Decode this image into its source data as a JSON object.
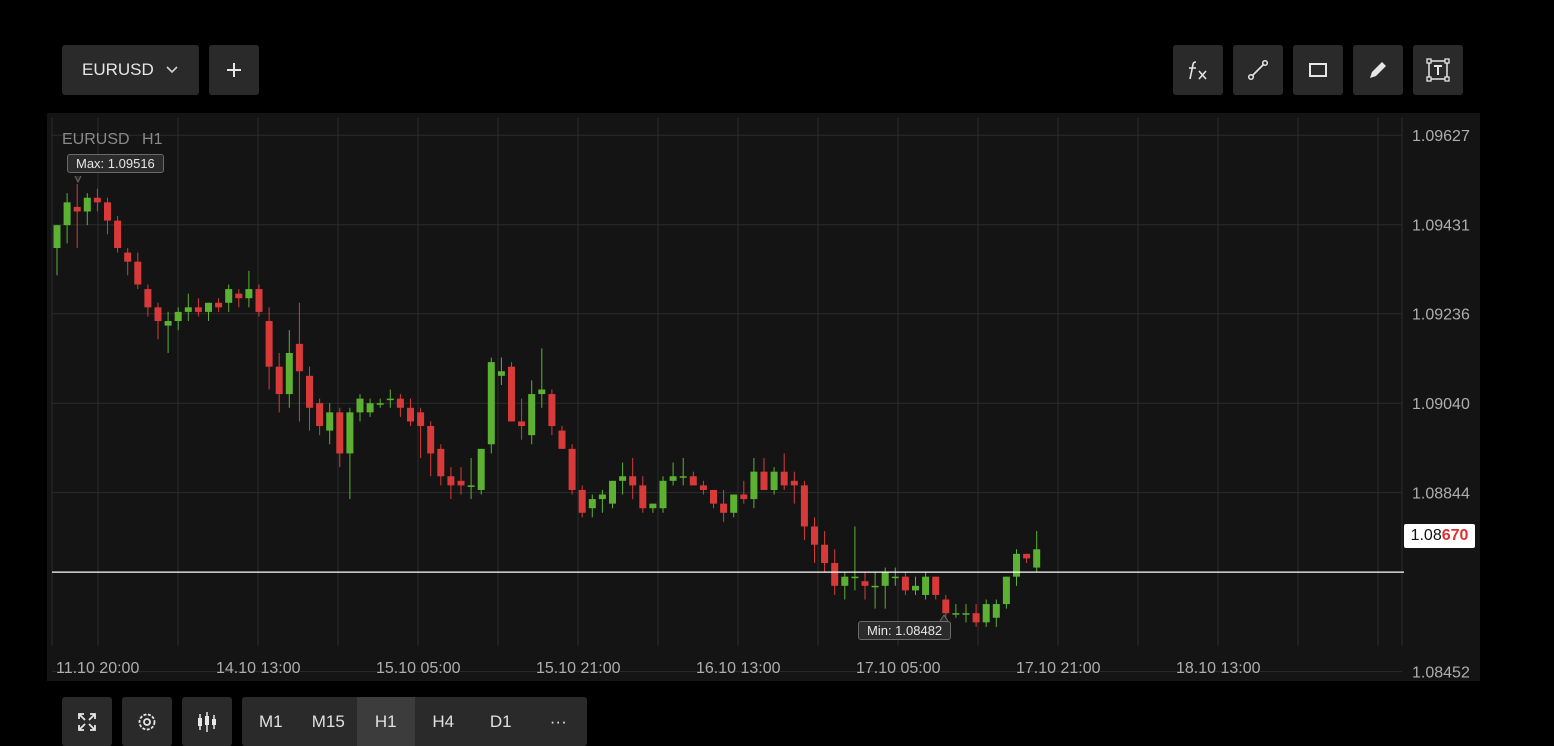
{
  "toolbar": {
    "symbol": "EURUSD",
    "add_icon": "plus-icon",
    "tools": [
      "function-icon",
      "trend-line-icon",
      "rectangle-icon",
      "pencil-icon",
      "text-icon"
    ]
  },
  "chart_header": {
    "symbol": "EURUSD",
    "timeframe": "H1"
  },
  "annotations": {
    "max_label": "Max: 1.09516",
    "min_label": "Min: 1.08482"
  },
  "current_price": {
    "prefix": "1.08",
    "highlight": "670",
    "value": 1.0867
  },
  "bottom_bar": {
    "tools": [
      "fullscreen-icon",
      "settings-icon",
      "candles-icon"
    ],
    "timeframes": [
      "M1",
      "M15",
      "H1",
      "H4",
      "D1",
      "···"
    ],
    "active_timeframe": "H1"
  },
  "colors": {
    "up": "#5db132",
    "down": "#d83a3a",
    "background": "#141414",
    "grid": "#2b2b2b",
    "price_line": "#ffffff",
    "price_text": "#e03030"
  },
  "chart_data": {
    "type": "candlestick",
    "y_ticks": [
      "1.09627",
      "1.09431",
      "1.09236",
      "1.09040",
      "1.08844",
      "1.08452"
    ],
    "x_ticks": [
      "11.10 20:00",
      "14.10 13:00",
      "15.10 05:00",
      "15.10 21:00",
      "16.10 13:00",
      "17.10 05:00",
      "17.10 21:00",
      "18.10 13:00"
    ],
    "ylim": [
      1.084315,
      1.096757
    ],
    "grid": true,
    "candles": [
      [
        1.0938,
        1.0943,
        1.0932,
        1.0943
      ],
      [
        1.0943,
        1.095,
        1.0939,
        1.0948
      ],
      [
        1.0947,
        1.0952,
        1.0938,
        1.0946
      ],
      [
        1.0946,
        1.095,
        1.0943,
        1.0949
      ],
      [
        1.0949,
        1.0951,
        1.0946,
        1.0948
      ],
      [
        1.0948,
        1.0949,
        1.0941,
        1.0944
      ],
      [
        1.0944,
        1.0945,
        1.0937,
        1.0938
      ],
      [
        1.0937,
        1.0938,
        1.0932,
        1.0935
      ],
      [
        1.0935,
        1.0937,
        1.0929,
        1.093
      ],
      [
        1.0929,
        1.093,
        1.0923,
        1.0925
      ],
      [
        1.0925,
        1.0926,
        1.0918,
        1.0922
      ],
      [
        1.0921,
        1.0924,
        1.0915,
        1.0922
      ],
      [
        1.0922,
        1.0925,
        1.092,
        1.0924
      ],
      [
        1.0924,
        1.0928,
        1.0922,
        1.0925
      ],
      [
        1.0925,
        1.0927,
        1.0923,
        1.0924
      ],
      [
        1.0924,
        1.0926,
        1.0922,
        1.0926
      ],
      [
        1.0926,
        1.0927,
        1.0924,
        1.0925
      ],
      [
        1.0926,
        1.093,
        1.0924,
        1.0929
      ],
      [
        1.0928,
        1.0929,
        1.0925,
        1.0927
      ],
      [
        1.0927,
        1.0933,
        1.0925,
        1.0929
      ],
      [
        1.0929,
        1.093,
        1.0923,
        1.0924
      ],
      [
        1.0922,
        1.0925,
        1.0907,
        1.0912
      ],
      [
        1.0912,
        1.0915,
        1.0902,
        1.0906
      ],
      [
        1.0906,
        1.092,
        1.0903,
        1.0915
      ],
      [
        1.0917,
        1.0926,
        1.09,
        1.0911
      ],
      [
        1.091,
        1.0912,
        1.0898,
        1.0903
      ],
      [
        1.0904,
        1.0905,
        1.0897,
        1.0899
      ],
      [
        1.0898,
        1.0904,
        1.0895,
        1.0902
      ],
      [
        1.0902,
        1.0903,
        1.089,
        1.0893
      ],
      [
        1.0893,
        1.0903,
        1.0883,
        1.0902
      ],
      [
        1.0902,
        1.0906,
        1.09,
        1.0905
      ],
      [
        1.0902,
        1.0905,
        1.0901,
        1.0904
      ],
      [
        1.0904,
        1.0905,
        1.0903,
        1.0904
      ],
      [
        1.0905,
        1.0907,
        1.0903,
        1.0905
      ],
      [
        1.0905,
        1.0906,
        1.0901,
        1.0903
      ],
      [
        1.0903,
        1.0905,
        1.0899,
        1.09
      ],
      [
        1.0902,
        1.0903,
        1.0892,
        1.0899
      ],
      [
        1.0899,
        1.09,
        1.0888,
        1.0893
      ],
      [
        1.0894,
        1.0895,
        1.0886,
        1.0888
      ],
      [
        1.0888,
        1.089,
        1.0883,
        1.0886
      ],
      [
        1.0887,
        1.089,
        1.0884,
        1.0886
      ],
      [
        1.0886,
        1.0892,
        1.0883,
        1.0886
      ],
      [
        1.0885,
        1.0894,
        1.0884,
        1.0894
      ],
      [
        1.0895,
        1.0914,
        1.0893,
        1.0913
      ],
      [
        1.091,
        1.0914,
        1.0908,
        1.0911
      ],
      [
        1.0912,
        1.0913,
        1.09,
        1.09
      ],
      [
        1.09,
        1.0905,
        1.0896,
        1.0899
      ],
      [
        1.0897,
        1.0909,
        1.0895,
        1.0906
      ],
      [
        1.0906,
        1.0916,
        1.0903,
        1.0907
      ],
      [
        1.0906,
        1.0907,
        1.0897,
        1.0899
      ],
      [
        1.0898,
        1.0899,
        1.0894,
        1.0894
      ],
      [
        1.0894,
        1.0895,
        1.0884,
        1.0885
      ],
      [
        1.0885,
        1.0886,
        1.0879,
        1.088
      ],
      [
        1.0881,
        1.0884,
        1.0879,
        1.0883
      ],
      [
        1.0883,
        1.0885,
        1.088,
        1.0884
      ],
      [
        1.0882,
        1.0887,
        1.0881,
        1.0887
      ],
      [
        1.0887,
        1.0891,
        1.0884,
        1.0888
      ],
      [
        1.0888,
        1.0892,
        1.0883,
        1.0886
      ],
      [
        1.0886,
        1.0888,
        1.088,
        1.0881
      ],
      [
        1.0881,
        1.0882,
        1.088,
        1.0882
      ],
      [
        1.0881,
        1.0888,
        1.088,
        1.0887
      ],
      [
        1.0887,
        1.0891,
        1.0886,
        1.0888
      ],
      [
        1.0888,
        1.0892,
        1.0886,
        1.0888
      ],
      [
        1.0888,
        1.0889,
        1.0886,
        1.0886
      ],
      [
        1.0886,
        1.0887,
        1.0884,
        1.0885
      ],
      [
        1.0885,
        1.0885,
        1.0881,
        1.0882
      ],
      [
        1.0882,
        1.0885,
        1.0878,
        1.088
      ],
      [
        1.088,
        1.0884,
        1.0879,
        1.0884
      ],
      [
        1.0884,
        1.0887,
        1.0882,
        1.0883
      ],
      [
        1.0883,
        1.0892,
        1.0881,
        1.0889
      ],
      [
        1.0889,
        1.0892,
        1.0885,
        1.0885
      ],
      [
        1.0885,
        1.089,
        1.0884,
        1.0889
      ],
      [
        1.0889,
        1.0893,
        1.0885,
        1.0886
      ],
      [
        1.0887,
        1.0889,
        1.0882,
        1.0886
      ],
      [
        1.0886,
        1.0887,
        1.0874,
        1.0877
      ],
      [
        1.0877,
        1.0879,
        1.0869,
        1.0873
      ],
      [
        1.0873,
        1.0876,
        1.0867,
        1.0869
      ],
      [
        1.0869,
        1.0872,
        1.0862,
        1.0864
      ],
      [
        1.0864,
        1.0867,
        1.0861,
        1.0866
      ],
      [
        1.0866,
        1.0877,
        1.0863,
        1.0866
      ],
      [
        1.0865,
        1.0867,
        1.0861,
        1.0864
      ],
      [
        1.0864,
        1.0867,
        1.0859,
        1.0864
      ],
      [
        1.0864,
        1.0868,
        1.0859,
        1.0867
      ],
      [
        1.0866,
        1.0868,
        1.0864,
        1.0866
      ],
      [
        1.0866,
        1.0867,
        1.0862,
        1.0863
      ],
      [
        1.0863,
        1.0866,
        1.0862,
        1.0864
      ],
      [
        1.0862,
        1.0867,
        1.0861,
        1.0866
      ],
      [
        1.0866,
        1.0866,
        1.0861,
        1.0862
      ],
      [
        1.0861,
        1.0862,
        1.0857,
        1.0858
      ],
      [
        1.0858,
        1.086,
        1.0857,
        1.0858
      ],
      [
        1.0858,
        1.086,
        1.0856,
        1.0858
      ],
      [
        1.0858,
        1.086,
        1.0855,
        1.0856
      ],
      [
        1.0856,
        1.0861,
        1.0855,
        1.086
      ],
      [
        1.0857,
        1.0861,
        1.0855,
        1.086
      ],
      [
        1.086,
        1.0866,
        1.0859,
        1.0866
      ],
      [
        1.0866,
        1.0872,
        1.0864,
        1.0871
      ],
      [
        1.0871,
        1.0871,
        1.0869,
        1.087
      ],
      [
        1.0868,
        1.0876,
        1.0867,
        1.0872
      ]
    ]
  }
}
